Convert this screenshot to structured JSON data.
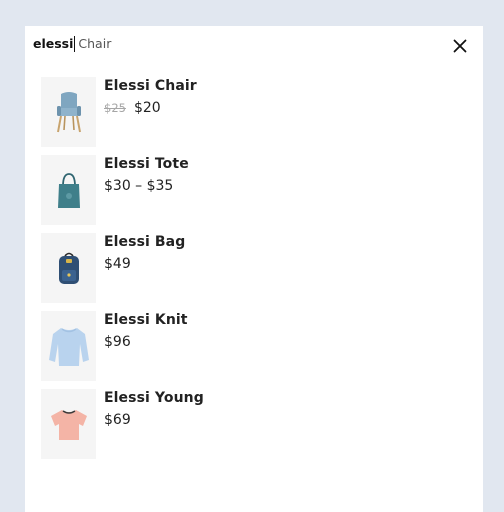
{
  "search": {
    "query": "elessi",
    "suggestion": "Chair"
  },
  "results": [
    {
      "name": "Elessi Chair",
      "old_price": "$25",
      "price": "$20",
      "icon": "chair-icon"
    },
    {
      "name": "Elessi Tote",
      "old_price": "",
      "price": "$30 – $35",
      "icon": "tote-bag-icon"
    },
    {
      "name": "Elessi Bag",
      "old_price": "",
      "price": "$49",
      "icon": "backpack-icon"
    },
    {
      "name": "Elessi Knit",
      "old_price": "",
      "price": "$96",
      "icon": "knit-sweater-icon"
    },
    {
      "name": "Elessi Young",
      "old_price": "",
      "price": "$69",
      "icon": "t-shirt-icon"
    }
  ],
  "colors": {
    "background": "#e1e7f0",
    "panel": "#ffffff",
    "thumb_bg": "#f5f5f5",
    "chair": "#7fa6c0",
    "tote": "#3f7f8a",
    "backpack": "#2f4f74",
    "knit": "#b9d3ee",
    "tshirt": "#f4b4a6"
  }
}
